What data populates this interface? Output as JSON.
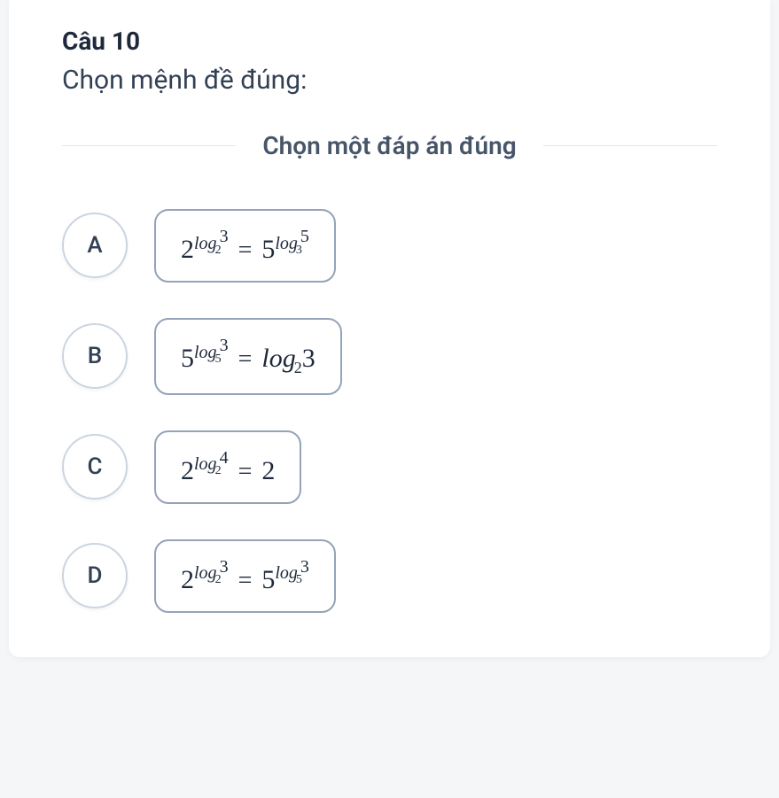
{
  "question": {
    "number": "Câu 10",
    "prompt": "Chọn mệnh đề đúng:",
    "instruction": "Chọn một đáp án đúng"
  },
  "options": [
    {
      "letter": "A",
      "formula_text": "2^(log_2 3) = 5^(log_3 5)",
      "lhs_base": "2",
      "lhs_exp_log_base": "2",
      "lhs_exp_log_arg": "3",
      "rhs_type": "power",
      "rhs_base": "5",
      "rhs_exp_log_base": "3",
      "rhs_exp_log_arg": "5"
    },
    {
      "letter": "B",
      "formula_text": "5^(log_5 3) = log_2 3",
      "lhs_base": "5",
      "lhs_exp_log_base": "5",
      "lhs_exp_log_arg": "3",
      "rhs_type": "log",
      "rhs_log_base": "2",
      "rhs_log_arg": "3"
    },
    {
      "letter": "C",
      "formula_text": "2^(log_2 4) = 2",
      "lhs_base": "2",
      "lhs_exp_log_base": "2",
      "lhs_exp_log_arg": "4",
      "rhs_type": "number",
      "rhs_value": "2"
    },
    {
      "letter": "D",
      "formula_text": "2^(log_2 3) = 5^(log_5 3)",
      "lhs_base": "2",
      "lhs_exp_log_base": "2",
      "lhs_exp_log_arg": "3",
      "rhs_type": "power",
      "rhs_base": "5",
      "rhs_exp_log_base": "5",
      "rhs_exp_log_arg": "3"
    }
  ]
}
